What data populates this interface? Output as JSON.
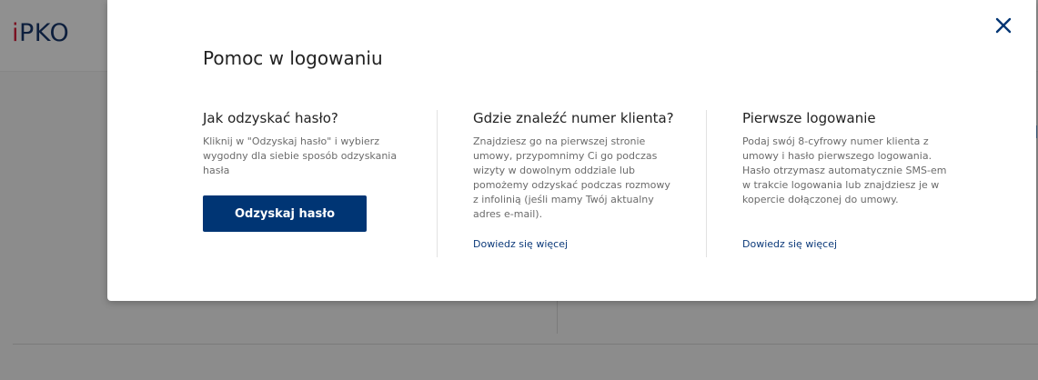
{
  "background": {
    "logo_prefix": "i",
    "logo_text": "PKO"
  },
  "modal": {
    "title": "Pomoc w logowaniu",
    "close_label": "×",
    "columns": [
      {
        "heading": "Jak odzyskać hasło?",
        "text": "Kliknij w \"Odzyskaj hasło\" i wybierz wygodny dla siebie sposób odzyskania hasła",
        "button_label": "Odzyskaj hasło"
      },
      {
        "heading": "Gdzie znaleźć numer klienta?",
        "text": "Znajdziesz go na pierwszej stronie umowy, przypomnimy Ci go podczas wizyty w dowolnym oddziale lub pomożemy odzyskać podczas rozmowy z infolinią (jeśli mamy Twój aktualny adres e-mail).",
        "link_label": "Dowiedz się więcej"
      },
      {
        "heading": "Pierwsze logowanie",
        "text": "Podaj swój 8-cyfrowy numer klienta z umowy i hasło pierwszego logowania. Hasło otrzymasz automatycznie SMS-em w trakcie logowania lub znajdziesz je w kopercie dołączonej do umowy.",
        "link_label": "Dowiedz się więcej"
      }
    ]
  },
  "colors": {
    "primary": "#003574",
    "link": "#0c3a7a",
    "overlay": "#8c8c8c"
  }
}
